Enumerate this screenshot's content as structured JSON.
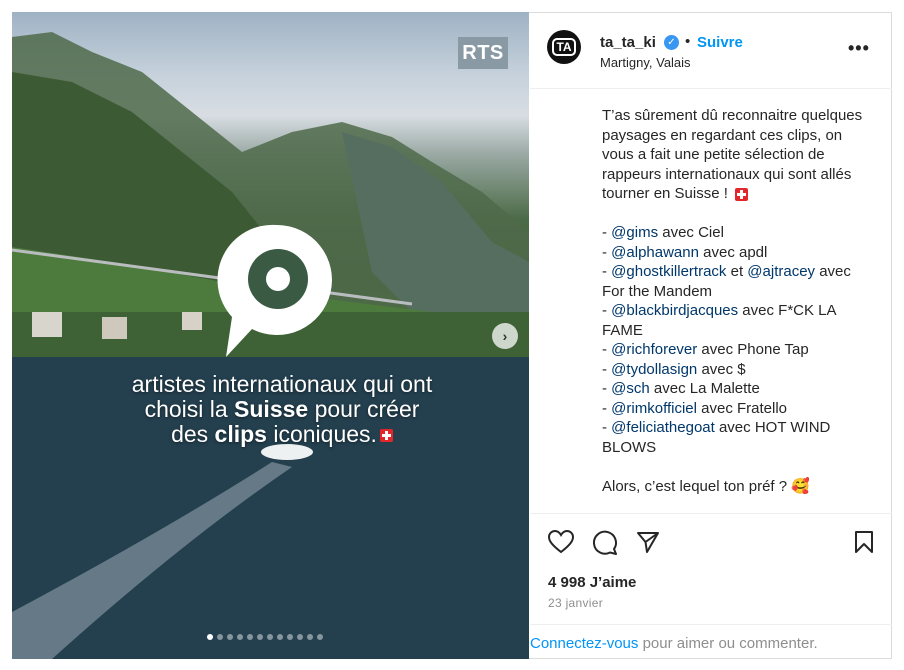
{
  "media": {
    "watermark": "RTS",
    "overlay_line1": "artistes internationaux qui ont",
    "overlay_line2_pre": "choisi la ",
    "overlay_line2_bold": "Suisse",
    "overlay_line2_post": " pour créer",
    "overlay_line3_pre": "des ",
    "overlay_line3_bold": "clips",
    "overlay_line3_post": " iconiques.",
    "carousel_total": 12,
    "carousel_active": 1
  },
  "header": {
    "username": "ta_ta_ki",
    "separator": "•",
    "follow_label": "Suivre",
    "location": "Martigny, Valais",
    "avatar_text": "TA"
  },
  "caption": {
    "intro": "T’as sûrement dû reconnaitre quelques paysages en regardant ces clips, on vous a fait une petite sélection de rappeurs internationaux qui sont allés tourner en Suisse !",
    "items": [
      {
        "mention": "@gims",
        "rest": " avec Ciel"
      },
      {
        "mention": "@alphawann",
        "rest": " avec apdl"
      },
      {
        "mention": "@ghostkillertrack",
        "mid": " et ",
        "mention2": "@ajtracey",
        "rest": " avec For the Mandem"
      },
      {
        "mention": "@blackbirdjacques",
        "rest": " avec F*CK LA FAME"
      },
      {
        "mention": "@richforever",
        "rest": " avec Phone Tap"
      },
      {
        "mention": "@tydollasign",
        "rest": " avec $"
      },
      {
        "mention": "@sch",
        "rest": " avec La Malette"
      },
      {
        "mention": "@rimkofficiel",
        "rest": " avec Fratello"
      },
      {
        "mention": "@feliciathegoat",
        "rest": " avec HOT WIND BLOWS"
      }
    ],
    "outro": "Alors, c’est lequel ton préf ? 🥰"
  },
  "post": {
    "likes": "4 998 J’aime",
    "date": "23 janvier"
  },
  "login": {
    "link": "Connectez-vous",
    "rest": " pour aimer ou commenter."
  }
}
